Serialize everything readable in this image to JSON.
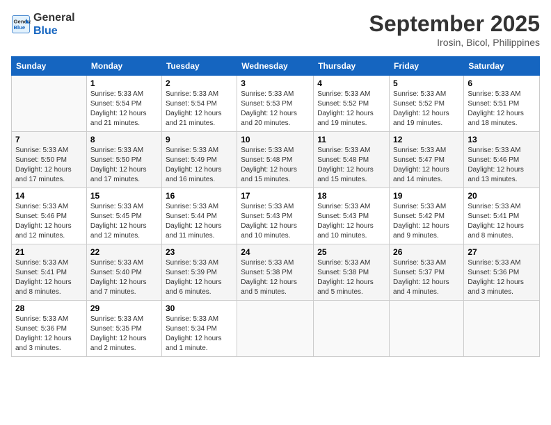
{
  "header": {
    "logo_line1": "General",
    "logo_line2": "Blue",
    "month": "September 2025",
    "location": "Irosin, Bicol, Philippines"
  },
  "days_of_week": [
    "Sunday",
    "Monday",
    "Tuesday",
    "Wednesday",
    "Thursday",
    "Friday",
    "Saturday"
  ],
  "weeks": [
    [
      {
        "day": "",
        "info": ""
      },
      {
        "day": "1",
        "info": "Sunrise: 5:33 AM\nSunset: 5:54 PM\nDaylight: 12 hours\nand 21 minutes."
      },
      {
        "day": "2",
        "info": "Sunrise: 5:33 AM\nSunset: 5:54 PM\nDaylight: 12 hours\nand 21 minutes."
      },
      {
        "day": "3",
        "info": "Sunrise: 5:33 AM\nSunset: 5:53 PM\nDaylight: 12 hours\nand 20 minutes."
      },
      {
        "day": "4",
        "info": "Sunrise: 5:33 AM\nSunset: 5:52 PM\nDaylight: 12 hours\nand 19 minutes."
      },
      {
        "day": "5",
        "info": "Sunrise: 5:33 AM\nSunset: 5:52 PM\nDaylight: 12 hours\nand 19 minutes."
      },
      {
        "day": "6",
        "info": "Sunrise: 5:33 AM\nSunset: 5:51 PM\nDaylight: 12 hours\nand 18 minutes."
      }
    ],
    [
      {
        "day": "7",
        "info": "Sunrise: 5:33 AM\nSunset: 5:50 PM\nDaylight: 12 hours\nand 17 minutes."
      },
      {
        "day": "8",
        "info": "Sunrise: 5:33 AM\nSunset: 5:50 PM\nDaylight: 12 hours\nand 17 minutes."
      },
      {
        "day": "9",
        "info": "Sunrise: 5:33 AM\nSunset: 5:49 PM\nDaylight: 12 hours\nand 16 minutes."
      },
      {
        "day": "10",
        "info": "Sunrise: 5:33 AM\nSunset: 5:48 PM\nDaylight: 12 hours\nand 15 minutes."
      },
      {
        "day": "11",
        "info": "Sunrise: 5:33 AM\nSunset: 5:48 PM\nDaylight: 12 hours\nand 15 minutes."
      },
      {
        "day": "12",
        "info": "Sunrise: 5:33 AM\nSunset: 5:47 PM\nDaylight: 12 hours\nand 14 minutes."
      },
      {
        "day": "13",
        "info": "Sunrise: 5:33 AM\nSunset: 5:46 PM\nDaylight: 12 hours\nand 13 minutes."
      }
    ],
    [
      {
        "day": "14",
        "info": "Sunrise: 5:33 AM\nSunset: 5:46 PM\nDaylight: 12 hours\nand 12 minutes."
      },
      {
        "day": "15",
        "info": "Sunrise: 5:33 AM\nSunset: 5:45 PM\nDaylight: 12 hours\nand 12 minutes."
      },
      {
        "day": "16",
        "info": "Sunrise: 5:33 AM\nSunset: 5:44 PM\nDaylight: 12 hours\nand 11 minutes."
      },
      {
        "day": "17",
        "info": "Sunrise: 5:33 AM\nSunset: 5:43 PM\nDaylight: 12 hours\nand 10 minutes."
      },
      {
        "day": "18",
        "info": "Sunrise: 5:33 AM\nSunset: 5:43 PM\nDaylight: 12 hours\nand 10 minutes."
      },
      {
        "day": "19",
        "info": "Sunrise: 5:33 AM\nSunset: 5:42 PM\nDaylight: 12 hours\nand 9 minutes."
      },
      {
        "day": "20",
        "info": "Sunrise: 5:33 AM\nSunset: 5:41 PM\nDaylight: 12 hours\nand 8 minutes."
      }
    ],
    [
      {
        "day": "21",
        "info": "Sunrise: 5:33 AM\nSunset: 5:41 PM\nDaylight: 12 hours\nand 8 minutes."
      },
      {
        "day": "22",
        "info": "Sunrise: 5:33 AM\nSunset: 5:40 PM\nDaylight: 12 hours\nand 7 minutes."
      },
      {
        "day": "23",
        "info": "Sunrise: 5:33 AM\nSunset: 5:39 PM\nDaylight: 12 hours\nand 6 minutes."
      },
      {
        "day": "24",
        "info": "Sunrise: 5:33 AM\nSunset: 5:38 PM\nDaylight: 12 hours\nand 5 minutes."
      },
      {
        "day": "25",
        "info": "Sunrise: 5:33 AM\nSunset: 5:38 PM\nDaylight: 12 hours\nand 5 minutes."
      },
      {
        "day": "26",
        "info": "Sunrise: 5:33 AM\nSunset: 5:37 PM\nDaylight: 12 hours\nand 4 minutes."
      },
      {
        "day": "27",
        "info": "Sunrise: 5:33 AM\nSunset: 5:36 PM\nDaylight: 12 hours\nand 3 minutes."
      }
    ],
    [
      {
        "day": "28",
        "info": "Sunrise: 5:33 AM\nSunset: 5:36 PM\nDaylight: 12 hours\nand 3 minutes."
      },
      {
        "day": "29",
        "info": "Sunrise: 5:33 AM\nSunset: 5:35 PM\nDaylight: 12 hours\nand 2 minutes."
      },
      {
        "day": "30",
        "info": "Sunrise: 5:33 AM\nSunset: 5:34 PM\nDaylight: 12 hours\nand 1 minute."
      },
      {
        "day": "",
        "info": ""
      },
      {
        "day": "",
        "info": ""
      },
      {
        "day": "",
        "info": ""
      },
      {
        "day": "",
        "info": ""
      }
    ]
  ]
}
